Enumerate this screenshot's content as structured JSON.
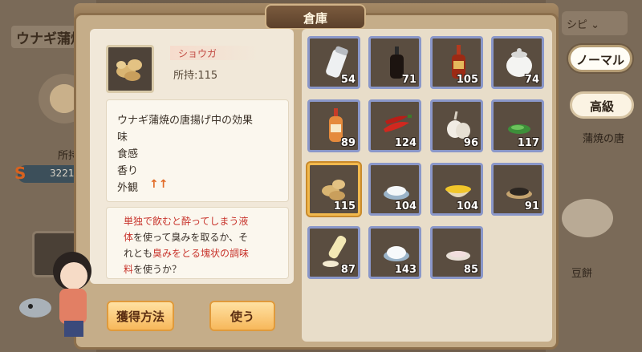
{
  "title": "倉庫",
  "background": {
    "dish_title": "ウナギ蒲焼",
    "owned_label": "所持",
    "owned_value": "3221/",
    "recipe_dropdown": "シピ ⌄",
    "right_label_1": "蒲焼の唐",
    "right_label_2": "豆餅"
  },
  "filter_tabs": {
    "normal": "ノーマル",
    "advanced": "高級"
  },
  "selected_item": {
    "name": "ショウガ",
    "owned": "所持:115",
    "effect_title": "ウナギ蒲焼の唐揚げ中の効果",
    "effects": [
      "味",
      "食感",
      "香り",
      "外観"
    ],
    "appearance_arrows": "↑↑"
  },
  "description": {
    "line1_red": "単独で飲むと酔ってしまう液",
    "line2_red": "体",
    "line2_rest": "を使って臭みを取るか、そ",
    "line3_pre": "れとも",
    "line3_red": "臭みをとる塊状の調味",
    "line4_red": "料",
    "line4_rest": "を使うか？"
  },
  "buttons": {
    "obtain": "獲得方法",
    "use": "使う"
  },
  "inventory": [
    {
      "icon": "salt-shaker-icon",
      "qty": "54"
    },
    {
      "icon": "soy-sauce-bottle-icon",
      "qty": "71"
    },
    {
      "icon": "sauce-bottle-icon",
      "qty": "105"
    },
    {
      "icon": "sugar-jar-icon",
      "qty": "74"
    },
    {
      "icon": "dressing-bottle-icon",
      "qty": "89"
    },
    {
      "icon": "chili-pepper-icon",
      "qty": "124"
    },
    {
      "icon": "garlic-icon",
      "qty": "96"
    },
    {
      "icon": "green-onion-icon",
      "qty": "117"
    },
    {
      "icon": "ginger-icon",
      "qty": "115",
      "selected": true
    },
    {
      "icon": "white-powder-icon",
      "qty": "104"
    },
    {
      "icon": "oil-bowl-icon",
      "qty": "104"
    },
    {
      "icon": "black-seeds-icon",
      "qty": "91"
    },
    {
      "icon": "mayonnaise-icon",
      "qty": "87"
    },
    {
      "icon": "rice-flour-icon",
      "qty": "143"
    },
    {
      "icon": "pink-salt-icon",
      "qty": "85"
    }
  ]
}
